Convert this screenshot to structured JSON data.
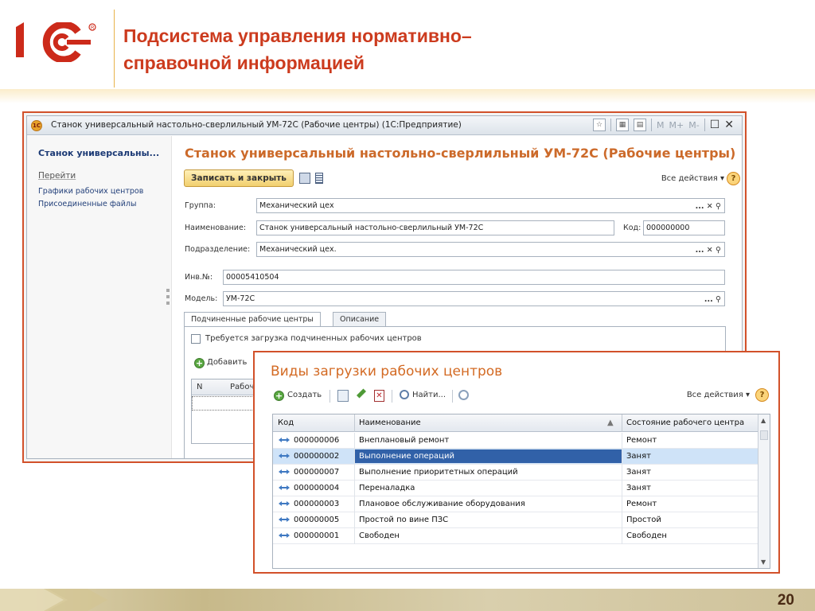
{
  "slide": {
    "title_line1": "Подсистема управления нормативно–",
    "title_line2": "справочной информацией",
    "page_number": "20",
    "logo_text": "1С",
    "accent_color": "#cc3b1e"
  },
  "main_window": {
    "titlebar": "Станок универсальный настольно-сверлильный УМ-72С (Рабочие центры)  (1С:Предприятие)",
    "memo_buttons": [
      "M",
      "M+",
      "M-"
    ],
    "sidebar": {
      "title": "Станок универсальны...",
      "go_label": "Перейти",
      "links": [
        "Графики рабочих центров",
        "Присоединенные файлы"
      ]
    },
    "form_title": "Станок универсальный настольно-сверлильный УМ-72С (Рабочие центры)",
    "save_close_label": "Записать и закрыть",
    "all_actions_label": "Все действия ▾",
    "help_label": "?",
    "fields": {
      "group_label": "Группа:",
      "group_value": "Механический цех",
      "name_label": "Наименование:",
      "name_value": "Станок универсальный настольно-сверлильный УМ-72С",
      "code_label": "Код:",
      "code_value": "000000000",
      "division_label": "Подразделение:",
      "division_value": "Механический цех.",
      "inv_label": "Инв.№:",
      "inv_value": "00005410504",
      "model_label": "Модель:",
      "model_value": "УМ-72С"
    },
    "tabs": [
      "Подчиненные рабочие центры",
      "Описание"
    ],
    "checkbox_label": "Требуется загрузка подчиненных рабочих центров",
    "add_label": "Добавить",
    "sub_columns": [
      "N",
      "Рабоч"
    ]
  },
  "load_window": {
    "title": "Виды загрузки рабочих центров",
    "create_label": "Создать",
    "find_label": "Найти...",
    "all_actions_label": "Все действия ▾",
    "help_label": "?",
    "columns": [
      "Код",
      "Наименование",
      "Состояние рабочего центра"
    ],
    "rows": [
      {
        "code": "000000006",
        "name": "Внеплановый ремонт",
        "state": "Ремонт"
      },
      {
        "code": "000000002",
        "name": "Выполнение операций",
        "state": "Занят"
      },
      {
        "code": "000000007",
        "name": "Выполнение приоритетных операций",
        "state": "Занят"
      },
      {
        "code": "000000004",
        "name": "Переналадка",
        "state": "Занят"
      },
      {
        "code": "000000003",
        "name": "Плановое обслуживание оборудования",
        "state": "Ремонт"
      },
      {
        "code": "000000005",
        "name": "Простой по вине ПЗС",
        "state": "Простой"
      },
      {
        "code": "000000001",
        "name": "Свободен",
        "state": "Свободен"
      }
    ],
    "selected_row": 1
  }
}
